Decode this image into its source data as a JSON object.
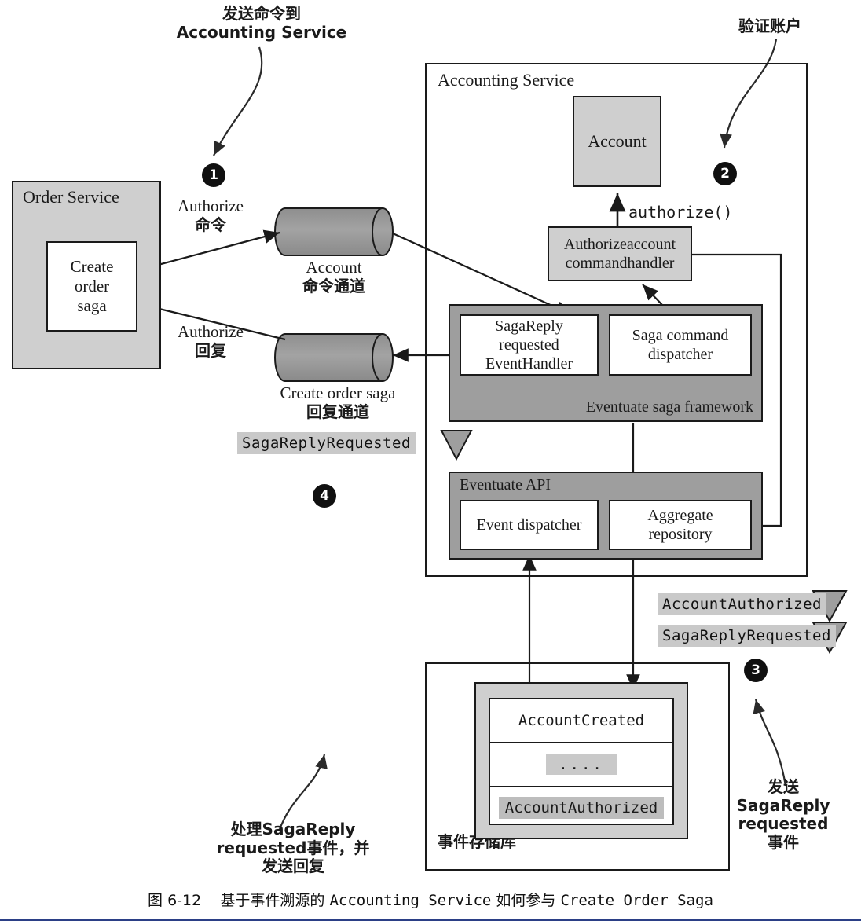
{
  "figure": {
    "caption_prefix": "图 6-12",
    "caption_part1": "基于事件溯源的",
    "caption_mono1": "Accounting Service",
    "caption_part2": "如何参与",
    "caption_mono2": "Create Order Saga"
  },
  "annotations": [
    {
      "id": "note-1",
      "lines": [
        "发送命令到",
        "Accounting Service"
      ],
      "step": "❶"
    },
    {
      "id": "note-2",
      "lines": [
        "验证账户"
      ],
      "step": "❷"
    },
    {
      "id": "note-3",
      "lines": [
        "发送",
        "SagaReply",
        "requested",
        "事件"
      ],
      "step": "❸"
    },
    {
      "id": "note-4",
      "lines": [
        "处理SagaReply",
        "requested事件，并",
        "发送回复"
      ],
      "step": "❹"
    }
  ],
  "steps": {
    "one": "1",
    "two": "2",
    "three": "3",
    "four": "4"
  },
  "order_service": {
    "title": "Order Service",
    "inner_box": [
      "Create",
      "order",
      "saga"
    ]
  },
  "channels": [
    {
      "id": "account-command-channel",
      "lines": [
        "Account",
        "命令通道"
      ]
    },
    {
      "id": "create-order-saga-reply-channel",
      "lines": [
        "Create order saga",
        "回复通道"
      ]
    }
  ],
  "edge_labels": [
    {
      "id": "authorize-command",
      "lines": [
        "Authorize",
        "命令"
      ]
    },
    {
      "id": "authorize-reply",
      "lines": [
        "Authorize",
        "回复"
      ]
    },
    {
      "id": "authorize-method",
      "text": "authorize()"
    }
  ],
  "accounting_service": {
    "title": "Accounting Service",
    "account_box": "Account",
    "command_handler": [
      "Authorizeaccount",
      "commandhandler"
    ],
    "saga_framework": {
      "title": "Eventuate saga framework",
      "boxes": [
        {
          "id": "saga-reply-requested-event-handler",
          "lines": [
            "SagaReply",
            "requested",
            "EventHandler"
          ]
        },
        {
          "id": "saga-command-dispatcher",
          "lines": [
            "Saga command",
            "dispatcher"
          ]
        }
      ]
    },
    "eventuate_api": {
      "title": "Eventuate API",
      "boxes": [
        {
          "id": "event-dispatcher",
          "lines": [
            "Event dispatcher"
          ]
        },
        {
          "id": "aggregate-repository",
          "lines": [
            "Aggregate",
            "repository"
          ]
        }
      ]
    }
  },
  "event_store": {
    "title": "事件存储库",
    "events": [
      "AccountCreated",
      "....",
      "AccountAuthorized"
    ]
  },
  "event_badges": [
    {
      "id": "badge-saga-reply-requested-left",
      "text": "SagaReplyRequested"
    },
    {
      "id": "badge-account-authorized",
      "text": "AccountAuthorized"
    },
    {
      "id": "badge-saga-reply-requested-right",
      "text": "SagaReplyRequested"
    }
  ],
  "colors": {
    "line": "#1a1a1a",
    "grey_fill": "#cfcfcf",
    "dark_grey_fill": "#9e9e9e",
    "badge_fill": "#c9c9c9",
    "step_fill": "#101010",
    "rule": "#2b3f86"
  }
}
